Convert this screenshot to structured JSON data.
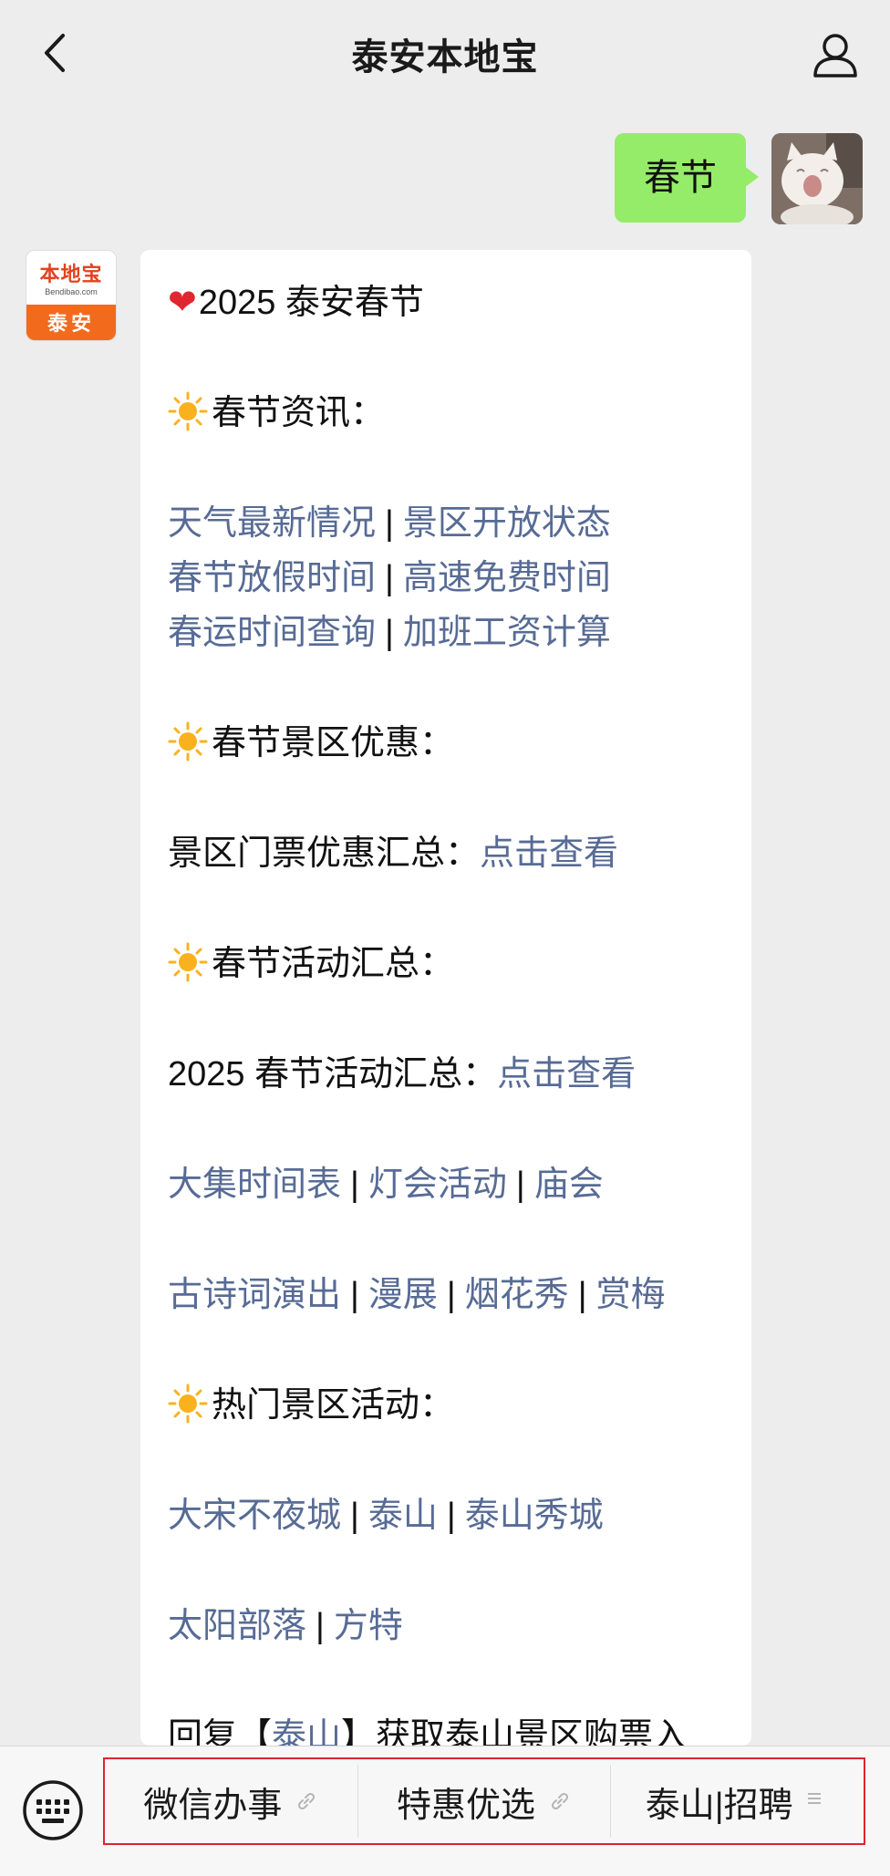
{
  "header": {
    "title": "泰安本地宝"
  },
  "outgoing": {
    "text": "春节"
  },
  "bot_avatar": {
    "brand": "本地宝",
    "url": "Bendibao.com",
    "city": "泰安"
  },
  "message": {
    "title": "2025 泰安春节",
    "sections": {
      "news": {
        "heading": "春节资讯：",
        "rows": [
          [
            "天气最新情况",
            "景区开放状态"
          ],
          [
            "春节放假时间",
            "高速免费时间"
          ],
          [
            "春运时间查询",
            "加班工资计算"
          ]
        ]
      },
      "discounts": {
        "heading": "春节景区优惠：",
        "text": "景区门票优惠汇总：",
        "link": "点击查看"
      },
      "events": {
        "heading": "春节活动汇总：",
        "text": "2025 春节活动汇总：",
        "link": "点击查看",
        "row1": [
          "大集时间表",
          "灯会活动",
          "庙会"
        ],
        "row2": [
          "古诗词演出",
          "漫展",
          "烟花秀",
          "赏梅"
        ]
      },
      "hot": {
        "heading": "热门景区活动：",
        "row1": [
          "大宋不夜城",
          "泰山",
          "泰山秀城"
        ],
        "row2": [
          "太阳部落",
          "方特"
        ],
        "reply_prefix": "回复【",
        "reply_keyword": "泰山",
        "reply_suffix": "】获取泰山景区购票入"
      }
    }
  },
  "menu": {
    "items": [
      {
        "label": "微信办事",
        "icon": "link-icon"
      },
      {
        "label": "特惠优选",
        "icon": "link-icon"
      },
      {
        "label": "泰山|招聘",
        "icon": "submenu-lines-icon"
      }
    ]
  },
  "colors": {
    "link": "#576b95",
    "bubble_out": "#95ec69",
    "highlight_border": "#e0232e"
  }
}
